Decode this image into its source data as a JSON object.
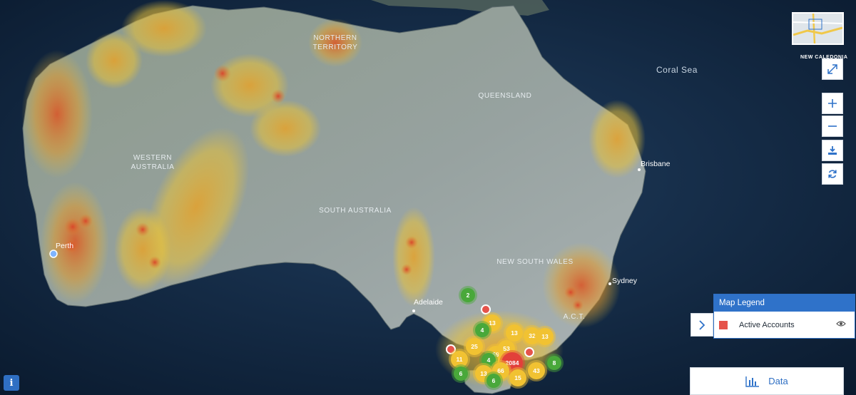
{
  "map": {
    "region_labels": [
      "NORTHERN",
      "TERRITORY",
      "QUEENSLAND",
      "WESTERN",
      "AUSTRALIA",
      "SOUTH AUSTRALIA",
      "NEW SOUTH WALES",
      "A.C.T."
    ],
    "city_labels": [
      "Perth",
      "Adelaide",
      "Sydney",
      "Brisbane"
    ],
    "sea_labels": [
      "Coral Sea"
    ],
    "minimap_text": "NEW CALEDONIA"
  },
  "clusters": [
    {
      "label": "2",
      "color": "green"
    },
    {
      "label": "13",
      "color": "yellow"
    },
    {
      "label": "4",
      "color": "green"
    },
    {
      "label": "13",
      "color": "yellow"
    },
    {
      "label": "32",
      "color": "yellow"
    },
    {
      "label": "13",
      "color": "yellow"
    },
    {
      "label": "25",
      "color": "yellow"
    },
    {
      "label": "69",
      "color": "yellow"
    },
    {
      "label": "53",
      "color": "yellow"
    },
    {
      "label": "11",
      "color": "yellow"
    },
    {
      "label": "4",
      "color": "green"
    },
    {
      "label": "2084",
      "color": "red"
    },
    {
      "label": "8",
      "color": "green"
    },
    {
      "label": "6",
      "color": "green"
    },
    {
      "label": "13",
      "color": "yellow"
    },
    {
      "label": "66",
      "color": "yellow"
    },
    {
      "label": "43",
      "color": "yellow"
    },
    {
      "label": "6",
      "color": "green"
    },
    {
      "label": "15",
      "color": "yellow"
    }
  ],
  "controls": {
    "fullscreen": "expand-icon",
    "zoom_in": "plus-icon",
    "zoom_out": "minus-icon",
    "download": "download-icon",
    "refresh": "refresh-icon"
  },
  "legend": {
    "title": "Map Legend",
    "items": [
      {
        "label": "Active Accounts",
        "color": "#e5534b"
      }
    ]
  },
  "data_button": {
    "label": "Data"
  },
  "info_button": {
    "label": "i"
  },
  "colors": {
    "accent": "#2f72c9",
    "cluster_green": "#49a83a",
    "cluster_yellow": "#f1c232",
    "cluster_red": "#e2403a"
  }
}
